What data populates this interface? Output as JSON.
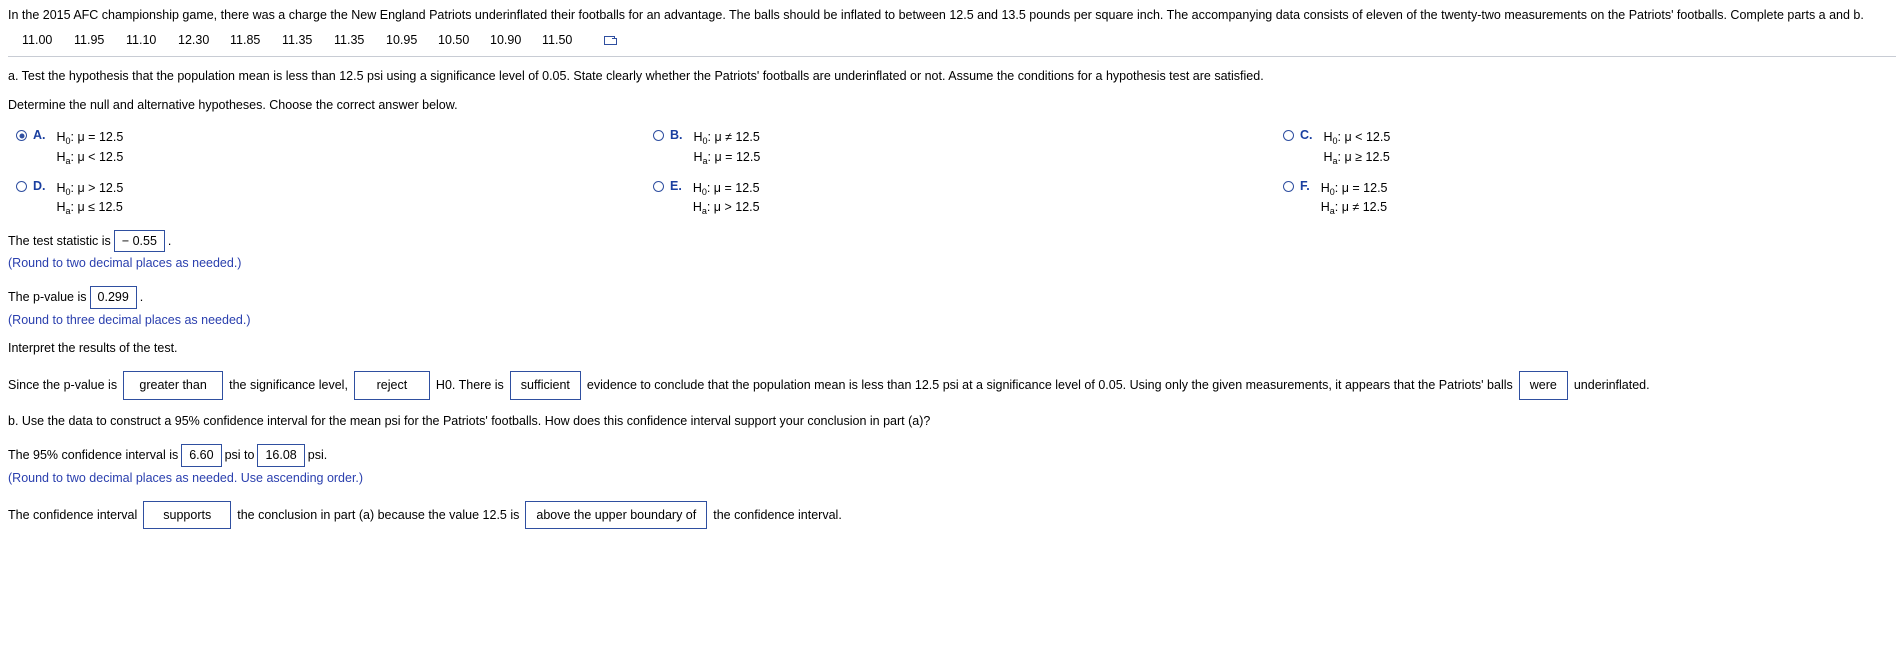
{
  "problem": {
    "statement": "In the 2015 AFC championship game, there was a charge the New England Patriots underinflated their footballs for an advantage. The balls should be inflated to between 12.5 and 13.5 pounds per square inch. The accompanying data consists of eleven of the twenty-two measurements on the Patriots' footballs. Complete parts a and b.",
    "data_values": [
      "11.00",
      "11.95",
      "11.10",
      "12.30",
      "11.85",
      "11.35",
      "11.35",
      "10.95",
      "10.50",
      "10.90",
      "11.50"
    ],
    "copy_icon": "copy-to-clipboard-icon"
  },
  "part_a": {
    "question": "a. Test the hypothesis that the population mean is less than 12.5 psi using a significance level of 0.05. State clearly whether the Patriots' footballs are underinflated or not. Assume the conditions for a hypothesis test are satisfied.",
    "instruction": "Determine the null and alternative hypotheses. Choose the correct answer below.",
    "choices": [
      {
        "letter": "A.",
        "null": "H₀: μ = 12.5",
        "alt": "Hₐ: μ < 12.5",
        "selected": true
      },
      {
        "letter": "B.",
        "null": "H₀: μ ≠ 12.5",
        "alt": "Hₐ: μ = 12.5",
        "selected": false
      },
      {
        "letter": "C.",
        "null": "H₀: μ < 12.5",
        "alt": "Hₐ: μ ≥ 12.5",
        "selected": false
      },
      {
        "letter": "D.",
        "null": "H₀: μ > 12.5",
        "alt": "Hₐ: μ ≤ 12.5",
        "selected": false
      },
      {
        "letter": "E.",
        "null": "H₀: μ = 12.5",
        "alt": "Hₐ: μ > 12.5",
        "selected": false
      },
      {
        "letter": "F.",
        "null": "H₀: μ = 12.5",
        "alt": "Hₐ: μ ≠ 12.5",
        "selected": false
      }
    ],
    "test_statistic": {
      "label_before": "The test statistic is",
      "value": "− 0.55",
      "label_after": ".",
      "hint": "(Round to two decimal places as needed.)"
    },
    "p_value": {
      "label_before": "The p-value is",
      "value": "0.299",
      "label_after": ".",
      "hint": "(Round to three decimal places as needed.)"
    },
    "interpret_prompt": "Interpret the results of the test.",
    "conclusion": {
      "t1": "Since the p-value is",
      "select1": "greater than",
      "t2": "the significance level,",
      "select2": "reject",
      "t3": "H₀. There is",
      "select3": "sufficient",
      "t4": "evidence to conclude that the population mean is less than 12.5 psi at a significance level of 0.05. Using only the given measurements, it appears that the Patriots' balls",
      "select4": "were",
      "t5": "underinflated."
    }
  },
  "part_b": {
    "question": "b. Use the data to construct a 95% confidence interval for the mean psi for the Patriots' footballs. How does this confidence interval support your conclusion in part (a)?",
    "ci": {
      "t1": "The 95% confidence interval is",
      "lower": "6.60",
      "t2": "psi to",
      "upper": "16.08",
      "t3": "psi.",
      "hint": "(Round to two decimal places as needed. Use ascending order.)"
    },
    "support": {
      "t1": "The confidence interval",
      "select1": "supports",
      "t2": "the conclusion in part (a) because the value 12.5 is",
      "select2": "above the upper boundary of",
      "t3": "the confidence interval."
    }
  },
  "colors": {
    "accent": "#2f4fa0",
    "hint": "#2a3fae",
    "rule": "#c8ccd4"
  }
}
